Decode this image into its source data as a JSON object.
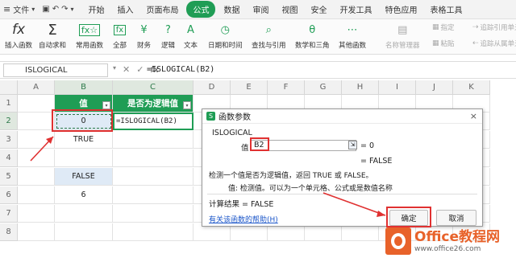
{
  "menubar": {
    "app_menu": "文件",
    "tabs": [
      "开始",
      "插入",
      "页面布局",
      "公式",
      "数据",
      "审阅",
      "视图",
      "安全",
      "开发工具",
      "特色应用",
      "表格工具"
    ],
    "active_tab": "公式"
  },
  "toolbar": {
    "items": [
      {
        "label": "插入函数",
        "icon": "fx-icon"
      },
      {
        "label": "自动求和",
        "icon": "sigma-icon"
      },
      {
        "label": "常用函数",
        "icon": "star-function-icon"
      },
      {
        "label": "全部",
        "icon": "all-functions-icon"
      },
      {
        "label": "财务",
        "icon": "finance-icon"
      },
      {
        "label": "逻辑",
        "icon": "logic-icon"
      },
      {
        "label": "文本",
        "icon": "text-icon"
      },
      {
        "label": "日期和时间",
        "icon": "clock-icon"
      },
      {
        "label": "查找与引用",
        "icon": "lookup-icon"
      },
      {
        "label": "数学和三角",
        "icon": "math-icon"
      },
      {
        "label": "其他函数",
        "icon": "other-functions-icon"
      },
      {
        "label": "名称管理器",
        "icon": "name-manager-icon"
      },
      {
        "label": "指定",
        "icon": "specify-icon"
      },
      {
        "label": "粘贴",
        "icon": "paste-icon"
      },
      {
        "label": "追踪引用单元格",
        "icon": "trace-precedents-icon"
      },
      {
        "label": "追踪从属单元格",
        "icon": "trace-dependents-icon"
      }
    ]
  },
  "formula_bar": {
    "namebox": "ISLOGICAL",
    "fx": "fx",
    "formula": "=ISLOGICAL(B2)"
  },
  "sheet": {
    "columns": [
      "A",
      "B",
      "C",
      "D",
      "E",
      "F",
      "G",
      "H",
      "I",
      "J",
      "K"
    ],
    "rows": [
      "1",
      "2",
      "3",
      "4",
      "5",
      "6",
      "7",
      "8"
    ],
    "header_b": "值",
    "header_c": "是否为逻辑值",
    "b2": "0",
    "b3": "TRUE",
    "b5": "FALSE",
    "b6": "6",
    "c2": "=ISLOGICAL(B2)"
  },
  "dialog": {
    "title": "函数参数",
    "function_name": "ISLOGICAL",
    "arg_label": "值",
    "arg_value": "B2",
    "arg_result": "= 0",
    "result_line": "= FALSE",
    "description": "检测一个值是否为逻辑值，返回 TRUE 或 FALSE。",
    "param_desc": "值:  检测值。可以为一个单元格、公式或是数值名称",
    "calc_result": "计算结果 = FALSE",
    "help_link": "有关该函数的帮助(H)",
    "ok_label": "确定",
    "cancel_label": "取消",
    "close": "×"
  },
  "watermark": {
    "brand": "Office教程网",
    "url": "www.office26.com"
  },
  "colors": {
    "accent": "#1f9d55",
    "highlight": "#e03131",
    "selection": "#dfeaf6",
    "logo_orange": "#e8622a"
  }
}
